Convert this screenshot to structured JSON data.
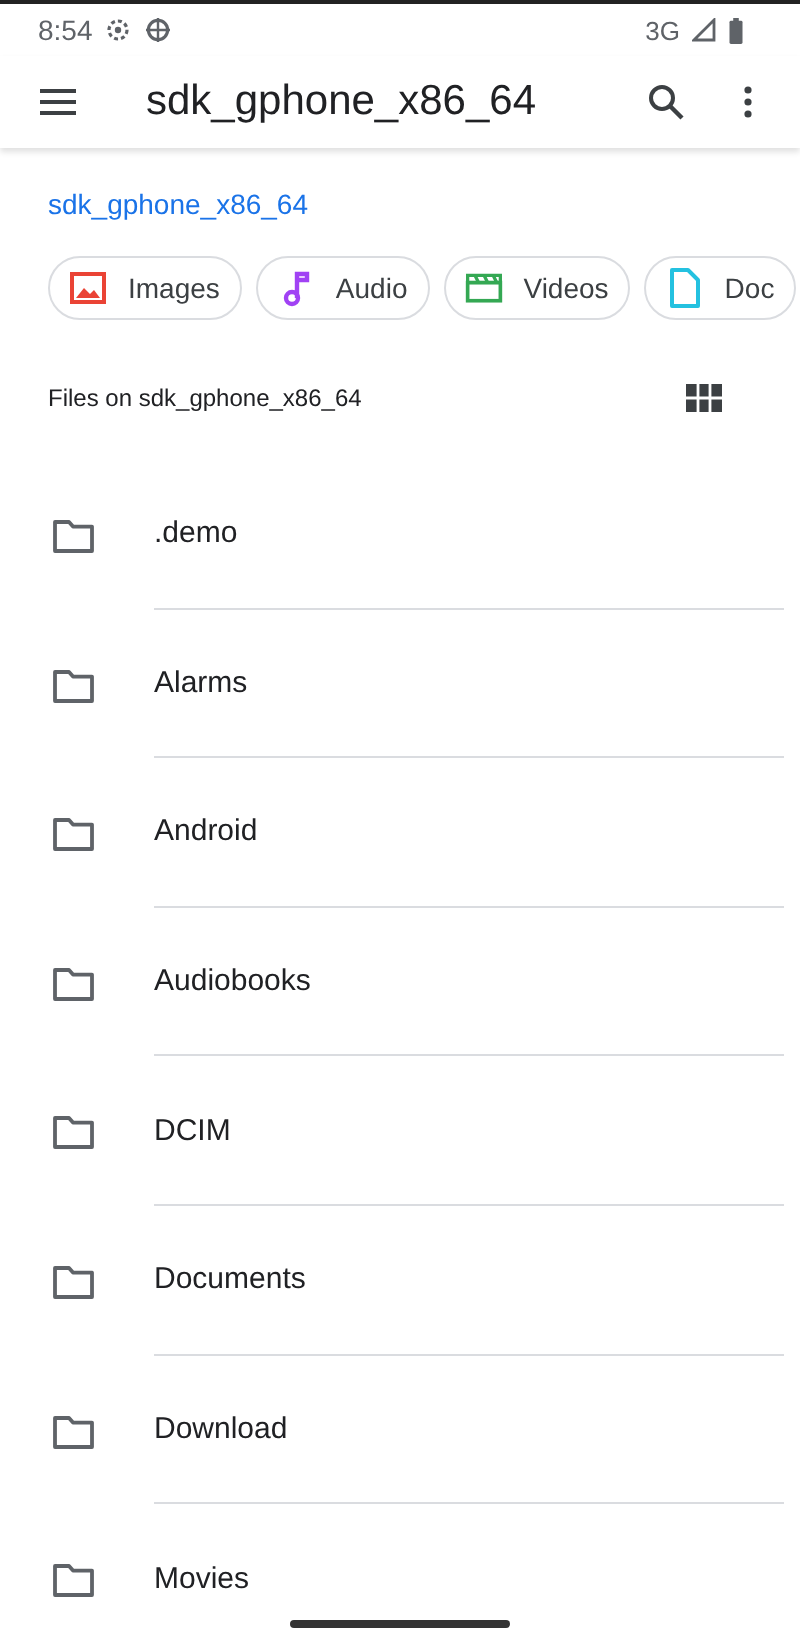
{
  "status_bar": {
    "time": "8:54",
    "network": "3G"
  },
  "toolbar": {
    "title": "sdk_gphone_x86_64"
  },
  "breadcrumb": "sdk_gphone_x86_64",
  "chips": [
    {
      "kind": "image",
      "label": "Images"
    },
    {
      "kind": "audio",
      "label": "Audio"
    },
    {
      "kind": "video",
      "label": "Videos"
    },
    {
      "kind": "document",
      "label": "Doc"
    }
  ],
  "section_title": "Files on sdk_gphone_x86_64",
  "folders": [
    {
      "name": ".demo"
    },
    {
      "name": "Alarms"
    },
    {
      "name": "Android"
    },
    {
      "name": "Audiobooks"
    },
    {
      "name": "DCIM"
    },
    {
      "name": "Documents"
    },
    {
      "name": "Download"
    },
    {
      "name": "Movies"
    }
  ]
}
